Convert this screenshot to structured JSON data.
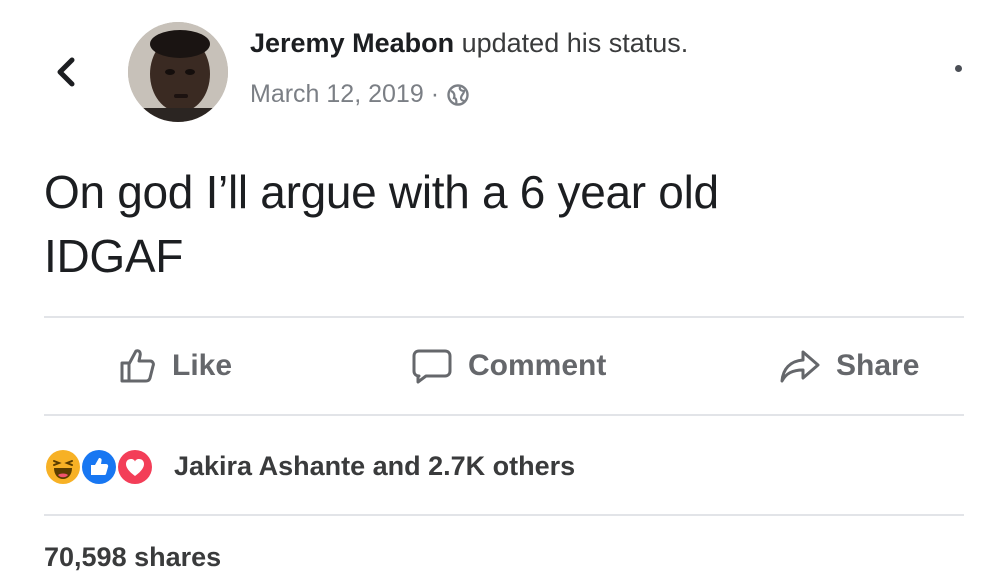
{
  "header": {
    "author_name": "Jeremy Meabon",
    "status_text": "updated his status.",
    "date": "March 12, 2019",
    "separator": "·",
    "privacy_icon": "globe-icon",
    "back_icon": "chevron-left-icon",
    "more_icon": "more-dot-icon"
  },
  "post": {
    "text_line_1": "On god I’ll argue with a 6 year old",
    "text_line_2": "IDGAF"
  },
  "actions": {
    "like_label": "Like",
    "comment_label": "Comment",
    "share_label": "Share",
    "like_icon": "thumbs-up-icon",
    "comment_icon": "comment-bubble-icon",
    "share_icon": "share-arrow-icon"
  },
  "reactions": {
    "icons": [
      "haha-reaction-icon",
      "like-reaction-icon",
      "love-reaction-icon"
    ],
    "summary": "Jakira Ashante and 2.7K others"
  },
  "footer": {
    "shares": "70,598 shares"
  },
  "colors": {
    "text_primary": "#1c1e21",
    "text_secondary": "#65676b",
    "meta": "#7b7f85",
    "divider": "#e2e4e8",
    "haha": "#f7b125",
    "like": "#1877f2",
    "love": "#f33e58"
  }
}
